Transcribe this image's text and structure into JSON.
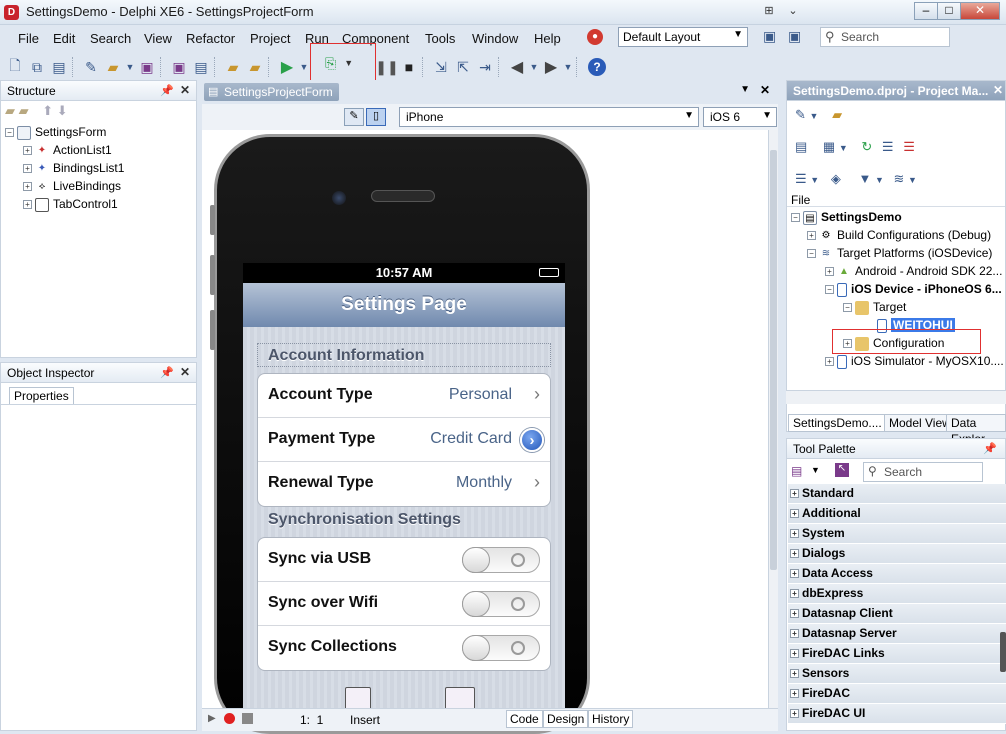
{
  "window": {
    "title": "SettingsDemo - Delphi XE6 - SettingsProjectForm",
    "app_icon": "delphi-logo-icon"
  },
  "menu": [
    "File",
    "Edit",
    "Search",
    "View",
    "Refactor",
    "Project",
    "Run",
    "Component",
    "Tools",
    "Window",
    "Help"
  ],
  "layout_select": {
    "value": "Default Layout"
  },
  "top_search": {
    "placeholder": "Search"
  },
  "structure": {
    "title": "Structure",
    "root": "SettingsForm",
    "children": [
      "ActionList1",
      "BindingsList1",
      "LiveBindings",
      "TabControl1"
    ]
  },
  "object_inspector": {
    "title": "Object Inspector",
    "tab": "Properties"
  },
  "designer": {
    "tab": "SettingsProjectForm",
    "device": "iPhone",
    "os": "iOS 6",
    "bottom_tabs": [
      "Code",
      "Design",
      "History"
    ],
    "position": "1:  1",
    "mode": "Insert"
  },
  "phone": {
    "time": "10:57 AM",
    "nav_title": "Settings Page",
    "section1": "Account Information",
    "rows1": [
      {
        "label": "Account Type",
        "value": "Personal",
        "accessory": "chevron"
      },
      {
        "label": "Payment Type",
        "value": "Credit Card",
        "accessory": "disclosure"
      },
      {
        "label": "Renewal Type",
        "value": "Monthly",
        "accessory": "chevron"
      }
    ],
    "section2": "Synchronisation Settings",
    "rows2": [
      {
        "label": "Sync via USB",
        "on": false
      },
      {
        "label": "Sync over Wifi",
        "on": false
      },
      {
        "label": "Sync Collections",
        "on": false
      }
    ]
  },
  "project_manager": {
    "title": "SettingsDemo.dproj - Project Ma...",
    "file_label": "File",
    "tree": [
      {
        "level": 0,
        "label": "SettingsDemo",
        "bold": true
      },
      {
        "level": 1,
        "label": "Build Configurations (Debug)"
      },
      {
        "level": 1,
        "label": "Target Platforms (iOSDevice)"
      },
      {
        "level": 2,
        "label": "Android - Android SDK 22..."
      },
      {
        "level": 2,
        "label": "iOS Device - iPhoneOS 6...",
        "bold": true
      },
      {
        "level": 3,
        "label": "Target"
      },
      {
        "level": 4,
        "label": "WEITOHUI",
        "selected": true
      },
      {
        "level": 3,
        "label": "Configuration"
      },
      {
        "level": 2,
        "label": "iOS Simulator - MyOSX10...."
      }
    ],
    "tabs": [
      "SettingsDemo....",
      "Model View",
      "Data Explor"
    ]
  },
  "tool_palette": {
    "title": "Tool Palette",
    "search_placeholder": "Search",
    "categories": [
      "Standard",
      "Additional",
      "System",
      "Dialogs",
      "Data Access",
      "dbExpress",
      "Datasnap Client",
      "Datasnap Server",
      "FireDAC Links",
      "Sensors",
      "FireDAC",
      "FireDAC UI"
    ]
  },
  "colors": {
    "highlight": "#e03030",
    "selection": "#3b7ae8"
  }
}
